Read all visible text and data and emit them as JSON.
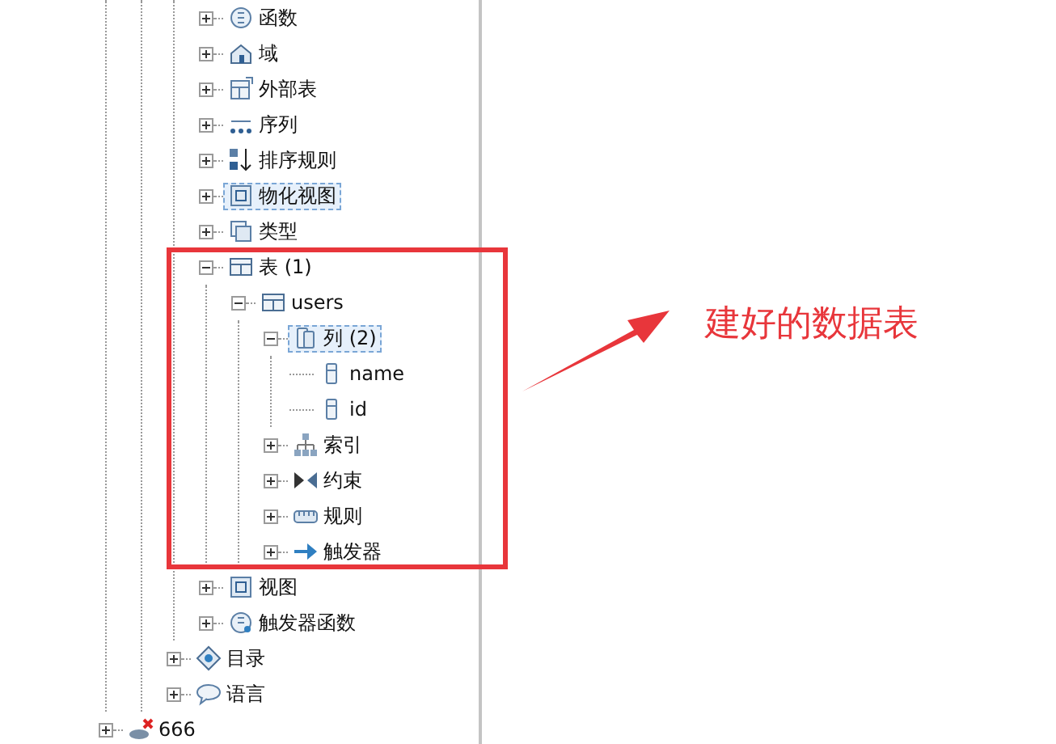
{
  "schema_items": [
    {
      "kind": "function",
      "label": "函数",
      "expanded": false,
      "selected": false
    },
    {
      "kind": "domain",
      "label": "域",
      "expanded": false,
      "selected": false
    },
    {
      "kind": "foreign-table",
      "label": "外部表",
      "expanded": false,
      "selected": false
    },
    {
      "kind": "sequence",
      "label": "序列",
      "expanded": false,
      "selected": false
    },
    {
      "kind": "collation",
      "label": "排序规则",
      "expanded": false,
      "selected": false
    },
    {
      "kind": "matview",
      "label": "物化视图",
      "expanded": false,
      "selected": true
    },
    {
      "kind": "type",
      "label": "类型",
      "expanded": false,
      "selected": false
    },
    {
      "kind": "tables",
      "label": "表 (1)",
      "expanded": true,
      "selected": false,
      "children": [
        {
          "kind": "table",
          "label": "users",
          "expanded": true,
          "selected": false,
          "children": [
            {
              "kind": "columns",
              "label": "列 (2)",
              "expanded": true,
              "selected": true,
              "children": [
                {
                  "kind": "column",
                  "label": "name",
                  "selected": false
                },
                {
                  "kind": "column",
                  "label": "id",
                  "selected": false
                }
              ]
            },
            {
              "kind": "index",
              "label": "索引",
              "expanded": false,
              "selected": false
            },
            {
              "kind": "constraint",
              "label": "约束",
              "expanded": false,
              "selected": false
            },
            {
              "kind": "rule",
              "label": "规则",
              "expanded": false,
              "selected": false
            },
            {
              "kind": "trigger",
              "label": "触发器",
              "expanded": false,
              "selected": false
            }
          ]
        }
      ]
    },
    {
      "kind": "view",
      "label": "视图",
      "expanded": false,
      "selected": false
    },
    {
      "kind": "trigger-function",
      "label": "触发器函数",
      "expanded": false,
      "selected": false
    }
  ],
  "database_items": [
    {
      "kind": "catalog",
      "label": "目录",
      "expanded": false,
      "selected": false
    },
    {
      "kind": "language",
      "label": "语言",
      "expanded": false,
      "selected": false
    }
  ],
  "servers": [
    {
      "kind": "server",
      "label": "666",
      "expanded": false,
      "selected": false
    }
  ],
  "annotation": {
    "text": "建好的数据表"
  }
}
